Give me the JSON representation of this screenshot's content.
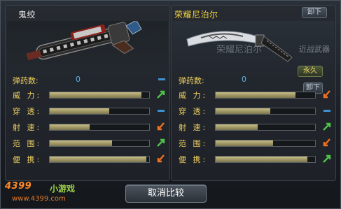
{
  "left": {
    "name": "鬼绞",
    "ammo_label": "弹药数:",
    "ammo_value": "0",
    "stats": [
      {
        "label": "威 力:",
        "fill": 0.92,
        "indicator": "green-up"
      },
      {
        "label": "穿 透:",
        "fill": 0.6,
        "indicator": "blue-dash"
      },
      {
        "label": "射 速:",
        "fill": 0.4,
        "indicator": "orange-down"
      },
      {
        "label": "范 围:",
        "fill": 0.63,
        "indicator": "green-up"
      },
      {
        "label": "便 携:",
        "fill": 0.97,
        "indicator": "orange-down"
      }
    ]
  },
  "right": {
    "name": "荣耀尼泊尔",
    "ghost_name": "荣耀尼泊尔",
    "type_label": "近战武器",
    "unload_label": "卸下",
    "forever_label": "永久",
    "ammo_label": "弹药数:",
    "ammo_value": "0",
    "stats": [
      {
        "label": "威 力:",
        "fill": 0.8,
        "indicator": "orange-down"
      },
      {
        "label": "穿 透:",
        "fill": 0.55,
        "indicator": "blue-dash"
      },
      {
        "label": "射 速:",
        "fill": 0.42,
        "indicator": "green-up"
      },
      {
        "label": "范 围:",
        "fill": 0.58,
        "indicator": "orange-down"
      },
      {
        "label": "便 携:",
        "fill": 0.92,
        "indicator": "green-up"
      }
    ]
  },
  "top_unload_label": "卸下",
  "cancel_label": "取消比较",
  "logo": {
    "brand": "4399",
    "sub": "小游戏",
    "url": "www.4399.com"
  },
  "colors": {
    "label": "#f0d060",
    "bar": "#9d9563",
    "up": "#4ec24a",
    "down": "#f0701e",
    "dash": "#3c90d0"
  }
}
